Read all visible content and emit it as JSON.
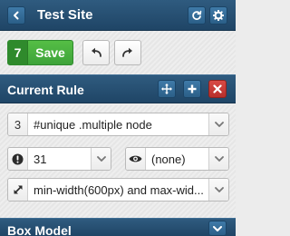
{
  "header": {
    "title": "Test Site",
    "back_icon": "chevron-left-icon",
    "refresh_icon": "refresh-icon",
    "settings_icon": "gear-icon"
  },
  "toolbar": {
    "save_count": "7",
    "save_label": "Save",
    "undo_icon": "undo-arrow-icon",
    "redo_icon": "redo-arrow-icon"
  },
  "current_rule": {
    "title": "Current Rule",
    "actions": [
      "move-icon",
      "plus-icon",
      "close-icon"
    ],
    "selector_count": "3",
    "selector": "#unique .multiple node",
    "specificity": "31",
    "visibility": "(none)",
    "media_query": "min-width(600px) and max-wid..."
  },
  "box_model": {
    "title": "Box Model",
    "toggle_icon": "chevron-down-icon"
  },
  "colors": {
    "header_bg": "#1f4566",
    "save_green": "#3ea33a",
    "delete_red": "#c0392b"
  }
}
